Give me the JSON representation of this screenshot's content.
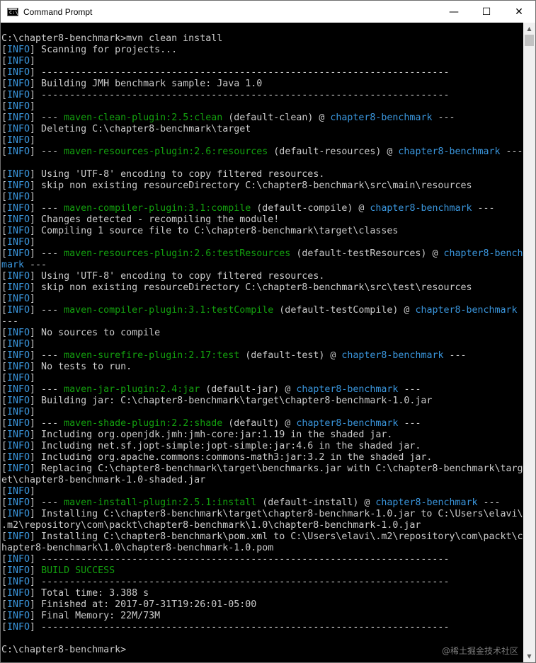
{
  "window": {
    "title": "Command Prompt",
    "icon_label": "C:\\",
    "controls": {
      "minimize": "—",
      "maximize": "☐",
      "close": "✕"
    }
  },
  "colors": {
    "info": "#3a96dd",
    "plugin": "#13a10e",
    "project": "#3a96dd",
    "text": "#c0c0c0",
    "background": "#000000"
  },
  "watermark": "@稀土掘金技术社区",
  "console": {
    "lines": [
      [
        [
          "w",
          "C:\\chapter8-benchmark>mvn clean install"
        ]
      ],
      [
        [
          "w",
          "["
        ],
        [
          "i",
          "INFO"
        ],
        [
          "w",
          "] Scanning for projects..."
        ]
      ],
      [
        [
          "w",
          "["
        ],
        [
          "i",
          "INFO"
        ],
        [
          "w",
          "]"
        ]
      ],
      [
        [
          "w",
          "["
        ],
        [
          "i",
          "INFO"
        ],
        [
          "w",
          "] ------------------------------------------------------------------------"
        ]
      ],
      [
        [
          "w",
          "["
        ],
        [
          "i",
          "INFO"
        ],
        [
          "w",
          "] Building JMH benchmark sample: Java 1.0"
        ]
      ],
      [
        [
          "w",
          "["
        ],
        [
          "i",
          "INFO"
        ],
        [
          "w",
          "] ------------------------------------------------------------------------"
        ]
      ],
      [
        [
          "w",
          "["
        ],
        [
          "i",
          "INFO"
        ],
        [
          "w",
          "]"
        ]
      ],
      [
        [
          "w",
          "["
        ],
        [
          "i",
          "INFO"
        ],
        [
          "w",
          "] --- "
        ],
        [
          "p",
          "maven-clean-plugin:2.5:clean"
        ],
        [
          "w",
          " (default-clean) @ "
        ],
        [
          "j",
          "chapter8-benchmark"
        ],
        [
          "w",
          " ---"
        ]
      ],
      [
        [
          "w",
          "["
        ],
        [
          "i",
          "INFO"
        ],
        [
          "w",
          "] Deleting C:\\chapter8-benchmark\\target"
        ]
      ],
      [
        [
          "w",
          "["
        ],
        [
          "i",
          "INFO"
        ],
        [
          "w",
          "]"
        ]
      ],
      [
        [
          "w",
          "["
        ],
        [
          "i",
          "INFO"
        ],
        [
          "w",
          "] --- "
        ],
        [
          "p",
          "maven-resources-plugin:2.6:resources"
        ],
        [
          "w",
          " (default-resources) @ "
        ],
        [
          "j",
          "chapter8-benchmark"
        ],
        [
          "w",
          " ---"
        ]
      ],
      [
        [
          "w",
          ""
        ]
      ],
      [
        [
          "w",
          "["
        ],
        [
          "i",
          "INFO"
        ],
        [
          "w",
          "] Using 'UTF-8' encoding to copy filtered resources."
        ]
      ],
      [
        [
          "w",
          "["
        ],
        [
          "i",
          "INFO"
        ],
        [
          "w",
          "] skip non existing resourceDirectory C:\\chapter8-benchmark\\src\\main\\resources"
        ]
      ],
      [
        [
          "w",
          "["
        ],
        [
          "i",
          "INFO"
        ],
        [
          "w",
          "]"
        ]
      ],
      [
        [
          "w",
          "["
        ],
        [
          "i",
          "INFO"
        ],
        [
          "w",
          "] --- "
        ],
        [
          "p",
          "maven-compiler-plugin:3.1:compile"
        ],
        [
          "w",
          " (default-compile) @ "
        ],
        [
          "j",
          "chapter8-benchmark"
        ],
        [
          "w",
          " ---"
        ]
      ],
      [
        [
          "w",
          "["
        ],
        [
          "i",
          "INFO"
        ],
        [
          "w",
          "] Changes detected - recompiling the module!"
        ]
      ],
      [
        [
          "w",
          "["
        ],
        [
          "i",
          "INFO"
        ],
        [
          "w",
          "] Compiling 1 source file to C:\\chapter8-benchmark\\target\\classes"
        ]
      ],
      [
        [
          "w",
          "["
        ],
        [
          "i",
          "INFO"
        ],
        [
          "w",
          "]"
        ]
      ],
      [
        [
          "w",
          "["
        ],
        [
          "i",
          "INFO"
        ],
        [
          "w",
          "] --- "
        ],
        [
          "p",
          "maven-resources-plugin:2.6:testResources"
        ],
        [
          "w",
          " (default-testResources) @ "
        ],
        [
          "j",
          "chapter8-bench"
        ]
      ],
      [
        [
          "j",
          "mark"
        ],
        [
          "w",
          " ---"
        ]
      ],
      [
        [
          "w",
          "["
        ],
        [
          "i",
          "INFO"
        ],
        [
          "w",
          "] Using 'UTF-8' encoding to copy filtered resources."
        ]
      ],
      [
        [
          "w",
          "["
        ],
        [
          "i",
          "INFO"
        ],
        [
          "w",
          "] skip non existing resourceDirectory C:\\chapter8-benchmark\\src\\test\\resources"
        ]
      ],
      [
        [
          "w",
          "["
        ],
        [
          "i",
          "INFO"
        ],
        [
          "w",
          "]"
        ]
      ],
      [
        [
          "w",
          "["
        ],
        [
          "i",
          "INFO"
        ],
        [
          "w",
          "] --- "
        ],
        [
          "p",
          "maven-compiler-plugin:3.1:testCompile"
        ],
        [
          "w",
          " (default-testCompile) @ "
        ],
        [
          "j",
          "chapter8-benchmark"
        ]
      ],
      [
        [
          "w",
          "---"
        ]
      ],
      [
        [
          "w",
          "["
        ],
        [
          "i",
          "INFO"
        ],
        [
          "w",
          "] No sources to compile"
        ]
      ],
      [
        [
          "w",
          "["
        ],
        [
          "i",
          "INFO"
        ],
        [
          "w",
          "]"
        ]
      ],
      [
        [
          "w",
          "["
        ],
        [
          "i",
          "INFO"
        ],
        [
          "w",
          "] --- "
        ],
        [
          "p",
          "maven-surefire-plugin:2.17:test"
        ],
        [
          "w",
          " (default-test) @ "
        ],
        [
          "j",
          "chapter8-benchmark"
        ],
        [
          "w",
          " ---"
        ]
      ],
      [
        [
          "w",
          "["
        ],
        [
          "i",
          "INFO"
        ],
        [
          "w",
          "] No tests to run."
        ]
      ],
      [
        [
          "w",
          "["
        ],
        [
          "i",
          "INFO"
        ],
        [
          "w",
          "]"
        ]
      ],
      [
        [
          "w",
          "["
        ],
        [
          "i",
          "INFO"
        ],
        [
          "w",
          "] --- "
        ],
        [
          "p",
          "maven-jar-plugin:2.4:jar"
        ],
        [
          "w",
          " (default-jar) @ "
        ],
        [
          "j",
          "chapter8-benchmark"
        ],
        [
          "w",
          " ---"
        ]
      ],
      [
        [
          "w",
          "["
        ],
        [
          "i",
          "INFO"
        ],
        [
          "w",
          "] Building jar: C:\\chapter8-benchmark\\target\\chapter8-benchmark-1.0.jar"
        ]
      ],
      [
        [
          "w",
          "["
        ],
        [
          "i",
          "INFO"
        ],
        [
          "w",
          "]"
        ]
      ],
      [
        [
          "w",
          "["
        ],
        [
          "i",
          "INFO"
        ],
        [
          "w",
          "] --- "
        ],
        [
          "p",
          "maven-shade-plugin:2.2:shade"
        ],
        [
          "w",
          " (default) @ "
        ],
        [
          "j",
          "chapter8-benchmark"
        ],
        [
          "w",
          " ---"
        ]
      ],
      [
        [
          "w",
          "["
        ],
        [
          "i",
          "INFO"
        ],
        [
          "w",
          "] Including org.openjdk.jmh:jmh-core:jar:1.19 in the shaded jar."
        ]
      ],
      [
        [
          "w",
          "["
        ],
        [
          "i",
          "INFO"
        ],
        [
          "w",
          "] Including net.sf.jopt-simple:jopt-simple:jar:4.6 in the shaded jar."
        ]
      ],
      [
        [
          "w",
          "["
        ],
        [
          "i",
          "INFO"
        ],
        [
          "w",
          "] Including org.apache.commons:commons-math3:jar:3.2 in the shaded jar."
        ]
      ],
      [
        [
          "w",
          "["
        ],
        [
          "i",
          "INFO"
        ],
        [
          "w",
          "] Replacing C:\\chapter8-benchmark\\target\\benchmarks.jar with C:\\chapter8-benchmark\\targ"
        ]
      ],
      [
        [
          "w",
          "et\\chapter8-benchmark-1.0-shaded.jar"
        ]
      ],
      [
        [
          "w",
          "["
        ],
        [
          "i",
          "INFO"
        ],
        [
          "w",
          "]"
        ]
      ],
      [
        [
          "w",
          "["
        ],
        [
          "i",
          "INFO"
        ],
        [
          "w",
          "] --- "
        ],
        [
          "p",
          "maven-install-plugin:2.5.1:install"
        ],
        [
          "w",
          " (default-install) @ "
        ],
        [
          "j",
          "chapter8-benchmark"
        ],
        [
          "w",
          " ---"
        ]
      ],
      [
        [
          "w",
          "["
        ],
        [
          "i",
          "INFO"
        ],
        [
          "w",
          "] Installing C:\\chapter8-benchmark\\target\\chapter8-benchmark-1.0.jar to C:\\Users\\elavi\\"
        ]
      ],
      [
        [
          "w",
          ".m2\\repository\\com\\packt\\chapter8-benchmark\\1.0\\chapter8-benchmark-1.0.jar"
        ]
      ],
      [
        [
          "w",
          "["
        ],
        [
          "i",
          "INFO"
        ],
        [
          "w",
          "] Installing C:\\chapter8-benchmark\\pom.xml to C:\\Users\\elavi\\.m2\\repository\\com\\packt\\c"
        ]
      ],
      [
        [
          "w",
          "hapter8-benchmark\\1.0\\chapter8-benchmark-1.0.pom"
        ]
      ],
      [
        [
          "w",
          "["
        ],
        [
          "i",
          "INFO"
        ],
        [
          "w",
          "] ------------------------------------------------------------------------"
        ]
      ],
      [
        [
          "w",
          "["
        ],
        [
          "i",
          "INFO"
        ],
        [
          "w",
          "] "
        ],
        [
          "s",
          "BUILD SUCCESS"
        ]
      ],
      [
        [
          "w",
          "["
        ],
        [
          "i",
          "INFO"
        ],
        [
          "w",
          "] ------------------------------------------------------------------------"
        ]
      ],
      [
        [
          "w",
          "["
        ],
        [
          "i",
          "INFO"
        ],
        [
          "w",
          "] Total time: 3.388 s"
        ]
      ],
      [
        [
          "w",
          "["
        ],
        [
          "i",
          "INFO"
        ],
        [
          "w",
          "] Finished at: 2017-07-31T19:26:01-05:00"
        ]
      ],
      [
        [
          "w",
          "["
        ],
        [
          "i",
          "INFO"
        ],
        [
          "w",
          "] Final Memory: 22M/73M"
        ]
      ],
      [
        [
          "w",
          "["
        ],
        [
          "i",
          "INFO"
        ],
        [
          "w",
          "] ------------------------------------------------------------------------"
        ]
      ],
      [
        [
          "w",
          ""
        ]
      ],
      [
        [
          "w",
          "C:\\chapter8-benchmark>"
        ]
      ]
    ]
  }
}
